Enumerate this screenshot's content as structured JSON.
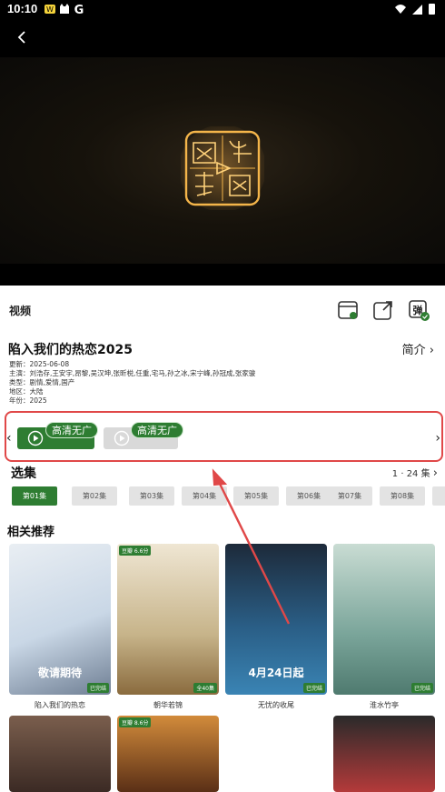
{
  "status": {
    "time": "10:10"
  },
  "video_label": "视频",
  "title": "陷入我们的热恋2025",
  "intro_label": "简介",
  "meta": [
    "更新：2025-06-08",
    "主演：刘浩存,王安宇,昂黎,吴汉坤,张昕棁,任重,宅马,孙之冰,宋宁峰,孙冠成,张家骏",
    "类型：剧情,爱情,国产",
    "地区：大陆",
    "年份：2025"
  ],
  "sources": [
    {
      "tag": "高清无广",
      "active": true
    },
    {
      "tag": "高清无广",
      "active": false
    }
  ],
  "episodes": {
    "label": "选集",
    "count_label": "1 · 24 集",
    "items": [
      "第01集",
      "第02集",
      "第03集",
      "第04集",
      "第05集",
      "第06集",
      "第07集",
      "第08集"
    ]
  },
  "recommend": {
    "label": "相关推荐",
    "items": [
      {
        "name": "陷入我们的热恋",
        "caption": "敬请期待",
        "score": "",
        "badge": "已完结",
        "colors": [
          "#c9d7e6",
          "#e9eef3"
        ]
      },
      {
        "name": "朝华若锦",
        "caption": "",
        "score": "豆瓣 6.6分",
        "badge": "全40集",
        "colors": [
          "#e9ddc7",
          "#c7b48a"
        ]
      },
      {
        "name": "无忧的收尾",
        "caption": "4月24日起",
        "score": "",
        "badge": "已完结",
        "colors": [
          "#1d2a3a",
          "#3a84b4"
        ]
      },
      {
        "name": "淮水竹亭",
        "caption": "",
        "score": "",
        "badge": "已完结",
        "colors": [
          "#7aa59a",
          "#c9dcd3"
        ]
      }
    ],
    "row2": [
      {
        "name": "",
        "score": "",
        "colors": [
          "#3b2a24",
          "#7a5e4d"
        ]
      },
      {
        "name": "",
        "score": "豆瓣 8.6分",
        "colors": [
          "#5a2f16",
          "#d28b3b"
        ]
      },
      {
        "name": "",
        "score": "",
        "colors": [
          "#2a2a2a",
          "#b43a3a"
        ]
      }
    ]
  }
}
